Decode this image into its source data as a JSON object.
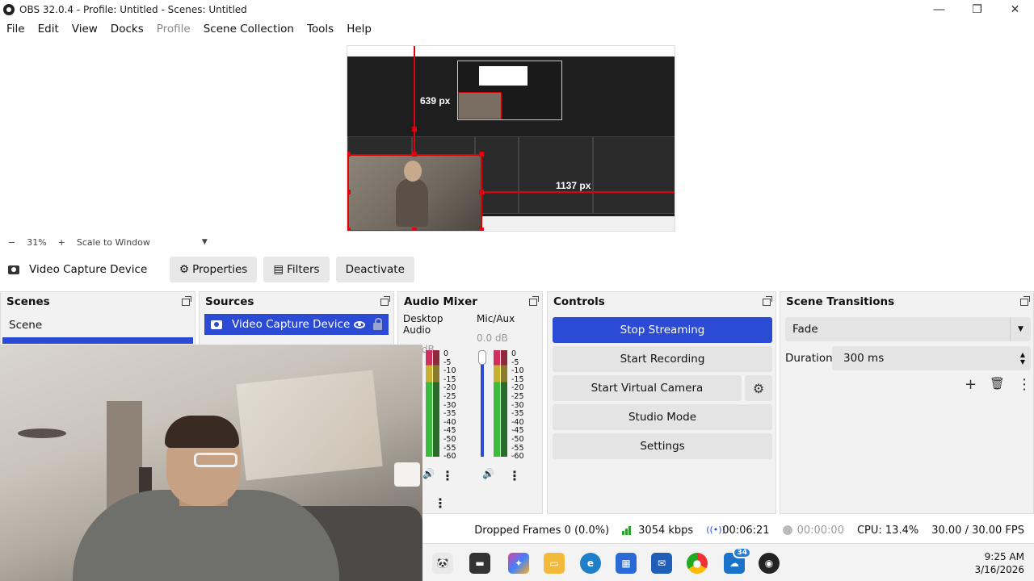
{
  "window": {
    "title": "OBS 32.0.4 - Profile: Untitled - Scenes: Untitled",
    "controls": [
      "minimize",
      "maximize",
      "close"
    ]
  },
  "menu": [
    "File",
    "Edit",
    "View",
    "Docks",
    "Profile",
    "Scene Collection",
    "Tools",
    "Help"
  ],
  "preview": {
    "measure_vertical": "639 px",
    "measure_horizontal": "1137 px"
  },
  "zoombar": {
    "minus": "−",
    "zoom": "31%",
    "plus": "+",
    "mode": "Scale to Window"
  },
  "source_toolbar": {
    "selected_source": "Video Capture Device",
    "properties": "Properties",
    "filters": "Filters",
    "deactivate": "Deactivate"
  },
  "scenes": {
    "title": "Scenes",
    "items": [
      "Scene"
    ]
  },
  "sources": {
    "title": "Sources",
    "items": [
      "Video Capture Device"
    ]
  },
  "audio_mixer": {
    "title": "Audio Mixer",
    "channels": [
      {
        "name": "Desktop Audio",
        "db": "0.0 dB"
      },
      {
        "name": "Mic/Aux",
        "db": "0.0 dB"
      }
    ],
    "scale": [
      "0",
      "-5",
      "-10",
      "-15",
      "-20",
      "-25",
      "-30",
      "-35",
      "-40",
      "-45",
      "-50",
      "-55",
      "-60"
    ]
  },
  "controls": {
    "title": "Controls",
    "stop_streaming": "Stop Streaming",
    "start_recording": "Start Recording",
    "start_virtual_camera": "Start Virtual Camera",
    "studio_mode": "Studio Mode",
    "settings": "Settings"
  },
  "transitions": {
    "title": "Scene Transitions",
    "selected": "Fade",
    "duration_label": "Duration",
    "duration_value": "300 ms"
  },
  "status": {
    "dropped_frames": "Dropped Frames 0 (0.0%)",
    "bitrate": "3054 kbps",
    "stream_time": "00:06:21",
    "rec_time": "00:00:00",
    "cpu": "CPU: 13.4%",
    "fps": "30.00 / 30.00 FPS"
  },
  "taskbar": {
    "badge": "34",
    "time": "9:25 AM",
    "date": "3/16/2026"
  },
  "colors": {
    "accent": "#2b4bd4",
    "handle_red": "#e00010"
  }
}
